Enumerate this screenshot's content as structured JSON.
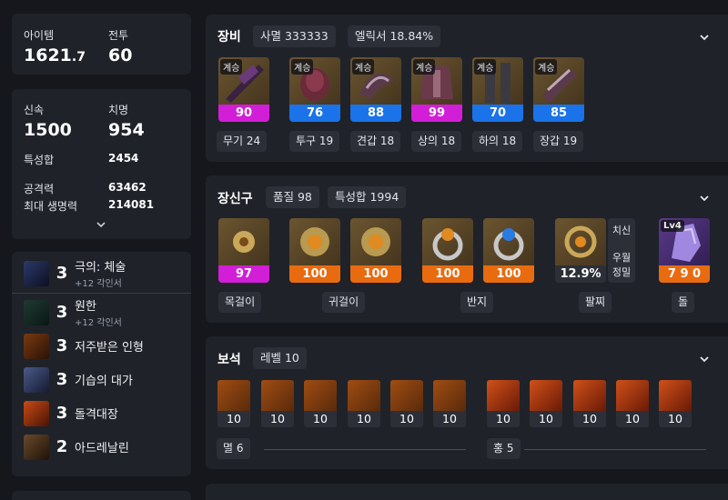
{
  "summary": {
    "item_label": "아이템",
    "item_value": "1621",
    "item_decimal": ".7",
    "battle_label": "전투",
    "battle_value": "60"
  },
  "stats": {
    "swift_label": "신속",
    "swift_value": "1500",
    "crit_label": "치명",
    "crit_value": "954",
    "spec_sum_label": "특성합",
    "spec_sum_value": "2454",
    "atk_label": "공격력",
    "atk_value": "63462",
    "hp_label": "최대 생명력",
    "hp_value": "214081"
  },
  "engravings": [
    {
      "level": "3",
      "name": "극의: 체술",
      "sub": "+12 각인서"
    },
    {
      "level": "3",
      "name": "원한",
      "sub": "+12 각인서"
    },
    {
      "level": "3",
      "name": "저주받은 인형",
      "sub": ""
    },
    {
      "level": "3",
      "name": "기습의 대가",
      "sub": ""
    },
    {
      "level": "3",
      "name": "돌격대장",
      "sub": ""
    },
    {
      "level": "2",
      "name": "아드레날린",
      "sub": ""
    }
  ],
  "equipment": {
    "title": "장비",
    "set_pill": "사멸 333333",
    "elixir_pill": "엘릭서 18.84%",
    "items": [
      {
        "tag": "계승",
        "quality": "90",
        "label": "무기 24"
      },
      {
        "tag": "계승",
        "quality": "76",
        "label": "투구 19"
      },
      {
        "tag": "계승",
        "quality": "88",
        "label": "견갑 18"
      },
      {
        "tag": "계승",
        "quality": "99",
        "label": "상의 18"
      },
      {
        "tag": "계승",
        "quality": "70",
        "label": "하의 18"
      },
      {
        "tag": "계승",
        "quality": "85",
        "label": "장갑 19"
      }
    ]
  },
  "accessories": {
    "title": "장신구",
    "quality_pill": "품질 98",
    "spec_pill": "특성합 1994",
    "items": [
      {
        "quality": "97"
      },
      {
        "quality": "100"
      },
      {
        "quality": "100"
      },
      {
        "quality": "100"
      },
      {
        "quality": "100"
      },
      {
        "quality": "12.9%"
      },
      {
        "tag": "Lv4",
        "quality": "7 9 0"
      }
    ],
    "bracelet_stat1": "치신",
    "bracelet_stat2": "우월",
    "bracelet_stat3": "정밀",
    "labels": {
      "necklace": "목걸이",
      "earring": "귀걸이",
      "ring": "반지",
      "bracelet": "팔찌",
      "stone": "돌"
    }
  },
  "gems": {
    "title": "보석",
    "level_pill": "레벨 10",
    "levels": [
      "10",
      "10",
      "10",
      "10",
      "10",
      "10",
      "10",
      "10",
      "10",
      "10",
      "10"
    ],
    "group1_label": "멸 6",
    "group2_label": "홍 5"
  }
}
